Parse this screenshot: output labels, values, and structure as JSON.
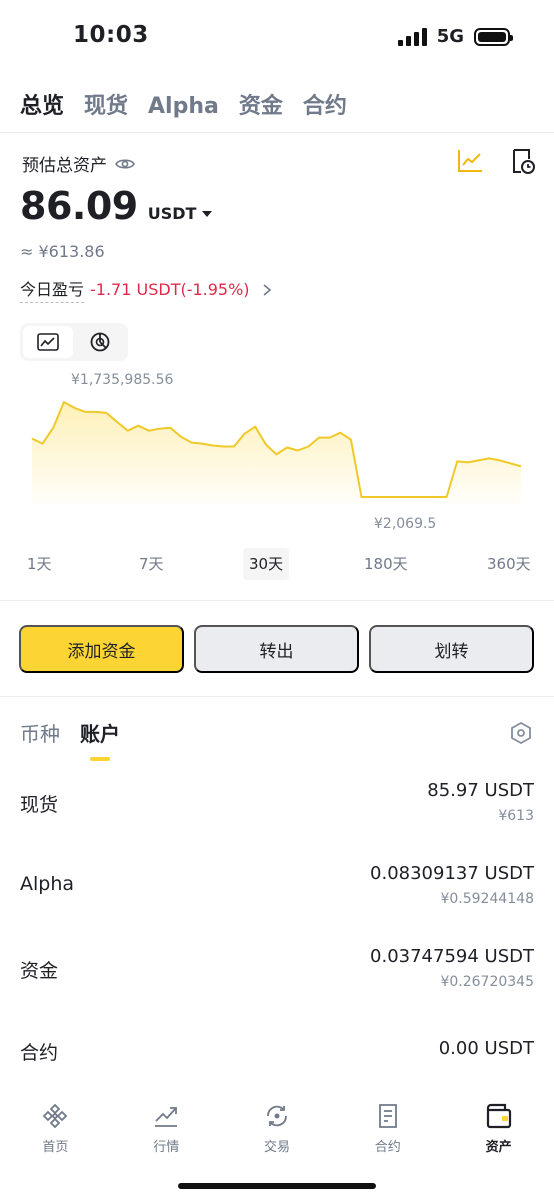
{
  "status_bar": {
    "time": "10:03",
    "network": "5G"
  },
  "top_tabs": [
    {
      "label": "总览",
      "active": true
    },
    {
      "label": "现货",
      "active": false
    },
    {
      "label": "Alpha",
      "active": false
    },
    {
      "label": "资金",
      "active": false
    },
    {
      "label": "合约",
      "active": false
    }
  ],
  "summary": {
    "label": "预估总资产",
    "balance": "86.09",
    "unit": "USDT",
    "cny": "≈ ¥613.86",
    "pnl_label": "今日盈亏",
    "pnl_value": "-1.71 USDT(-1.95%)"
  },
  "chart": {
    "max_label": "¥1,735,985.56",
    "min_label": "¥2,069.5",
    "ranges": [
      {
        "label": "1天",
        "active": false
      },
      {
        "label": "7天",
        "active": false
      },
      {
        "label": "30天",
        "active": true
      },
      {
        "label": "180天",
        "active": false
      },
      {
        "label": "360天",
        "active": false
      }
    ]
  },
  "chart_data": {
    "type": "area",
    "title": "",
    "xlabel": "",
    "ylabel": "",
    "values": [
      0.61,
      0.56,
      0.72,
      0.98,
      0.92,
      0.88,
      0.88,
      0.87,
      0.78,
      0.69,
      0.74,
      0.69,
      0.71,
      0.72,
      0.63,
      0.57,
      0.56,
      0.54,
      0.53,
      0.53,
      0.66,
      0.73,
      0.55,
      0.45,
      0.52,
      0.49,
      0.53,
      0.62,
      0.62,
      0.67,
      0.6,
      0.02,
      0.02,
      0.02,
      0.02,
      0.02,
      0.02,
      0.02,
      0.02,
      0.02,
      0.38,
      0.37,
      0.39,
      0.41,
      0.39,
      0.36,
      0.33
    ]
  },
  "actions": {
    "deposit": "添加资金",
    "withdraw": "转出",
    "transfer": "划转"
  },
  "sub_tabs": [
    {
      "label": "币种",
      "active": false
    },
    {
      "label": "账户",
      "active": true
    }
  ],
  "accounts": [
    {
      "name": "现货",
      "amount": "85.97 USDT",
      "cny": "¥613"
    },
    {
      "name": "Alpha",
      "amount": "0.08309137 USDT",
      "cny": "¥0.59244148"
    },
    {
      "name": "资金",
      "amount": "0.03747594 USDT",
      "cny": "¥0.26720345"
    },
    {
      "name": "合约",
      "amount": "0.00 USDT",
      "cny": ""
    }
  ],
  "bottom_nav": [
    {
      "label": "首页",
      "icon": "binance-logo-icon",
      "active": false
    },
    {
      "label": "行情",
      "icon": "trend-chart-icon",
      "active": false
    },
    {
      "label": "交易",
      "icon": "trade-swap-icon",
      "active": false
    },
    {
      "label": "合约",
      "icon": "futures-doc-icon",
      "active": false
    },
    {
      "label": "资产",
      "icon": "wallet-icon",
      "active": true
    }
  ],
  "colors": {
    "brand_yellow": "#fcd535",
    "loss_red": "#e0294a",
    "chart_line": "#f0c929"
  }
}
